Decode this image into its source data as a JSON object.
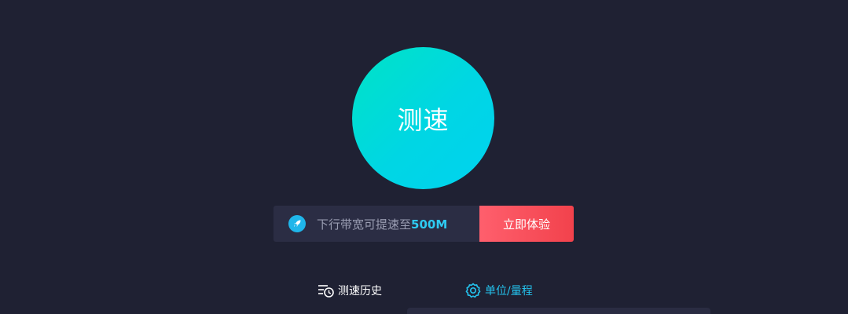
{
  "speed_test": {
    "button_label": "测速"
  },
  "promo": {
    "icon": "rocket-icon",
    "text_prefix": "下行带宽可提速至",
    "text_highlight": "500M",
    "cta_label": "立即体验"
  },
  "tabs": [
    {
      "label": "测速历史",
      "icon": "history-list-icon",
      "active": false
    },
    {
      "label": "单位/量程",
      "icon": "gear-icon",
      "active": true
    }
  ],
  "colors": {
    "background": "#1f2133",
    "circle_gradient_start": "#00e3c6",
    "circle_gradient_end": "#00d2f0",
    "promo_bar_bg": "#2b2d44",
    "highlight": "#2ecbf2",
    "cta_gradient_start": "#ff5f6d",
    "cta_gradient_end": "#f2424c",
    "active_tab": "#24c3ee"
  }
}
